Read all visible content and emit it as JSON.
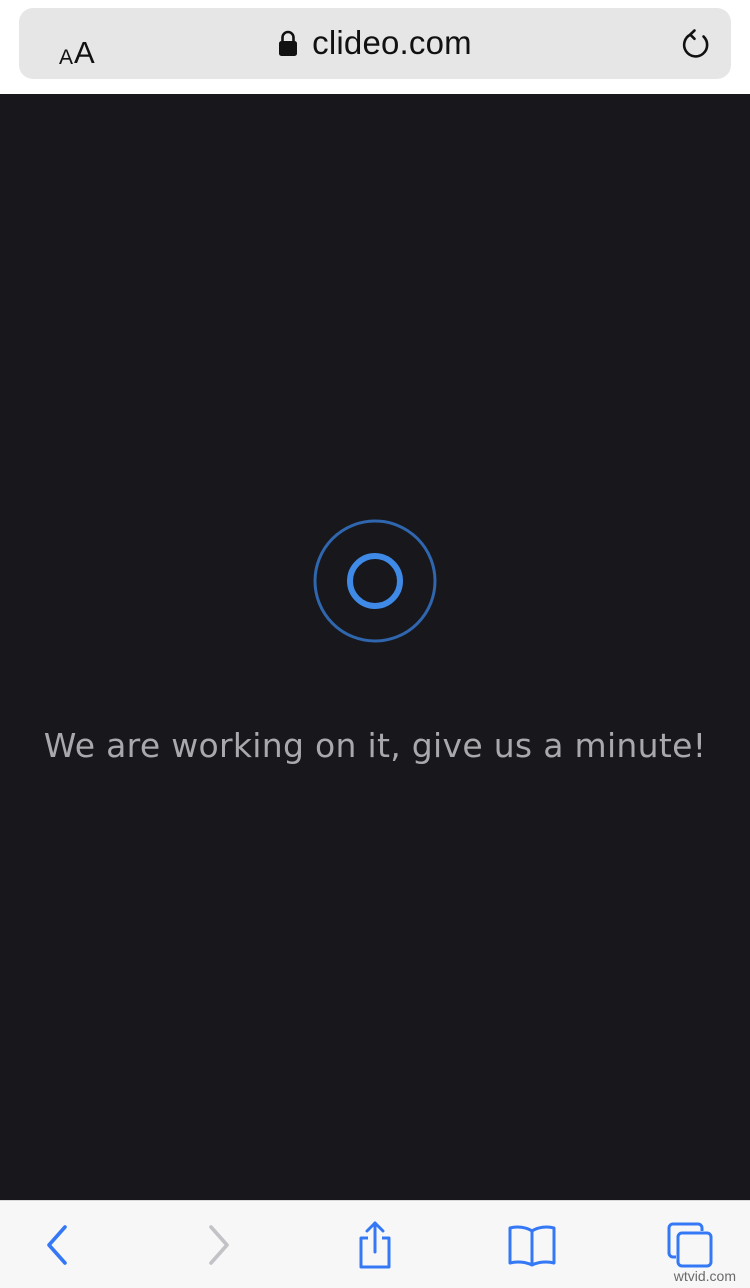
{
  "browser": {
    "text_size_small": "A",
    "text_size_large": "A",
    "url": "clideo.com",
    "lock_icon": "lock-icon",
    "reload_icon": "reload-icon"
  },
  "content": {
    "status_message": "We are working on it, give us a minute!",
    "spinner_icon": "loading-spinner-icon",
    "colors": {
      "background": "#17171c",
      "spinner_outer": "#2f66ad",
      "spinner_inner": "#3f8ae6",
      "text": "#a8a8ad"
    }
  },
  "toolbar": {
    "items": [
      {
        "icon": "back-icon",
        "enabled": true
      },
      {
        "icon": "forward-icon",
        "enabled": false
      },
      {
        "icon": "share-icon",
        "enabled": true
      },
      {
        "icon": "bookmarks-icon",
        "enabled": true
      },
      {
        "icon": "tabs-icon",
        "enabled": true
      }
    ],
    "accent_color": "#3478f6",
    "disabled_color": "#c2c2c7"
  },
  "watermark": "wtvid.com"
}
